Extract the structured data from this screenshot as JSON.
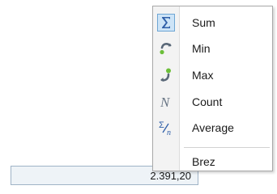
{
  "status_bar": {
    "value": "2.391,20"
  },
  "menu": {
    "items": [
      {
        "label": "Sum",
        "icon": "sigma-icon",
        "checked": true
      },
      {
        "label": "Min",
        "icon": "min-icon",
        "checked": false
      },
      {
        "label": "Max",
        "icon": "max-icon",
        "checked": false
      },
      {
        "label": "Count",
        "icon": "count-icon",
        "checked": false
      },
      {
        "label": "Average",
        "icon": "average-icon",
        "checked": false
      }
    ],
    "footer_item": {
      "label": "Brez"
    }
  },
  "colors": {
    "check_highlight": "#cde4f7",
    "icon_blue": "#2f5fa8",
    "icon_green": "#6cbf3a",
    "icon_gray": "#6a7786"
  }
}
